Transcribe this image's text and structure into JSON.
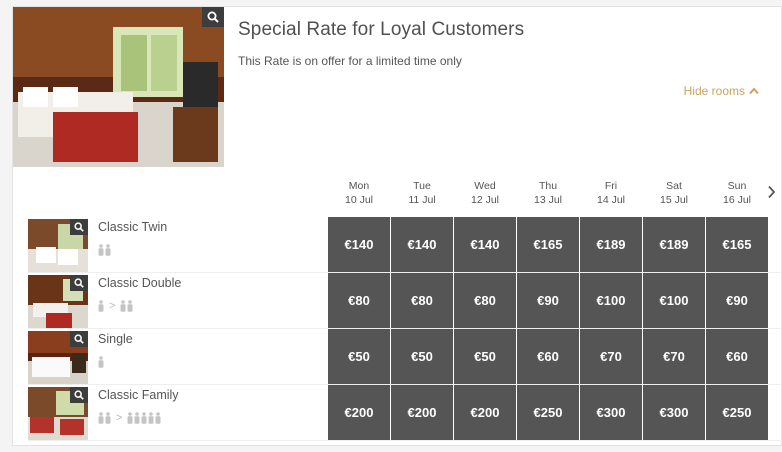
{
  "offer": {
    "title": "Special Rate for Loyal Customers",
    "subtitle": "This Rate is on offer for a limited time only",
    "hide_rooms_label": "Hide rooms"
  },
  "colors": {
    "accent": "#c9a55a",
    "price_cell": "#555555",
    "title_text": "#505050"
  },
  "icons": {
    "zoom": "magnifier-icon",
    "hide": "chevron-up-icon",
    "next": "chevron-right-icon",
    "person": "person-icon"
  },
  "dates": [
    {
      "day": "Mon",
      "date": "10 Jul"
    },
    {
      "day": "Tue",
      "date": "11 Jul"
    },
    {
      "day": "Wed",
      "date": "12 Jul"
    },
    {
      "day": "Thu",
      "date": "13 Jul"
    },
    {
      "day": "Fri",
      "date": "14 Jul"
    },
    {
      "day": "Sat",
      "date": "15 Jul"
    },
    {
      "day": "Sun",
      "date": "16 Jul"
    }
  ],
  "rooms": [
    {
      "name": "Classic Twin",
      "occupancy": {
        "min": 2,
        "max": 2
      },
      "prices": [
        "€140",
        "€140",
        "€140",
        "€165",
        "€189",
        "€189",
        "€165"
      ]
    },
    {
      "name": "Classic Double",
      "occupancy": {
        "min": 1,
        "max": 2
      },
      "prices": [
        "€80",
        "€80",
        "€80",
        "€90",
        "€100",
        "€100",
        "€90"
      ]
    },
    {
      "name": "Single",
      "occupancy": {
        "min": 1,
        "max": 1
      },
      "prices": [
        "€50",
        "€50",
        "€50",
        "€60",
        "€70",
        "€70",
        "€60"
      ]
    },
    {
      "name": "Classic Family",
      "occupancy": {
        "min": 2,
        "max": 5
      },
      "prices": [
        "€200",
        "€200",
        "€200",
        "€250",
        "€300",
        "€300",
        "€250"
      ]
    }
  ]
}
